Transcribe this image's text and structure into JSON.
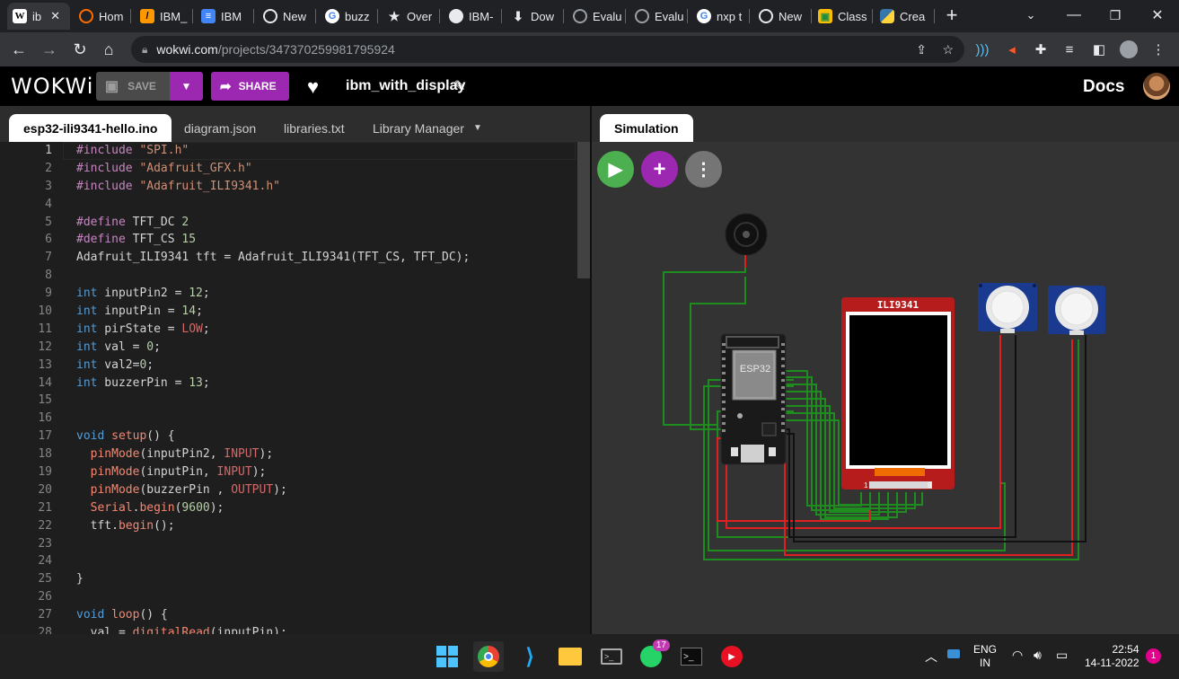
{
  "browser": {
    "tabs": [
      {
        "title": "ib",
        "active": true
      },
      {
        "title": "Hom"
      },
      {
        "title": "IBM_"
      },
      {
        "title": "IBM"
      },
      {
        "title": "New"
      },
      {
        "title": "buzz"
      },
      {
        "title": "Over"
      },
      {
        "title": "IBM-"
      },
      {
        "title": "Dow"
      },
      {
        "title": "Evalu"
      },
      {
        "title": "Evalu"
      },
      {
        "title": "nxp t"
      },
      {
        "title": "New"
      },
      {
        "title": "Class"
      },
      {
        "title": "Crea"
      }
    ],
    "url_host": "wokwi.com",
    "url_path": "/projects/347370259981795924"
  },
  "header": {
    "logo": "WOKWi",
    "save_label": "SAVE",
    "share_label": "SHARE",
    "project_name": "ibm_with_display",
    "docs_label": "Docs"
  },
  "editor": {
    "tabs": [
      "esp32-ili9341-hello.ino",
      "diagram.json",
      "libraries.txt",
      "Library Manager"
    ],
    "active_tab": 0,
    "current_line": 1
  },
  "simulation": {
    "tab_label": "Simulation",
    "display_label": "ILI9341",
    "chip_label": "ESP32",
    "pin_left": "1",
    "pin_right": "9"
  },
  "taskbar": {
    "whatsapp_badge": "17",
    "language": "ENG",
    "region": "IN",
    "time": "22:54",
    "date": "14-11-2022",
    "notification_count": "1"
  },
  "colors": {
    "wokwi_purple": "#9c27b0",
    "run_green": "#4caf50",
    "wire_green": "#1e8c1e",
    "wire_red": "#e02020",
    "board_red": "#b71c1c"
  }
}
